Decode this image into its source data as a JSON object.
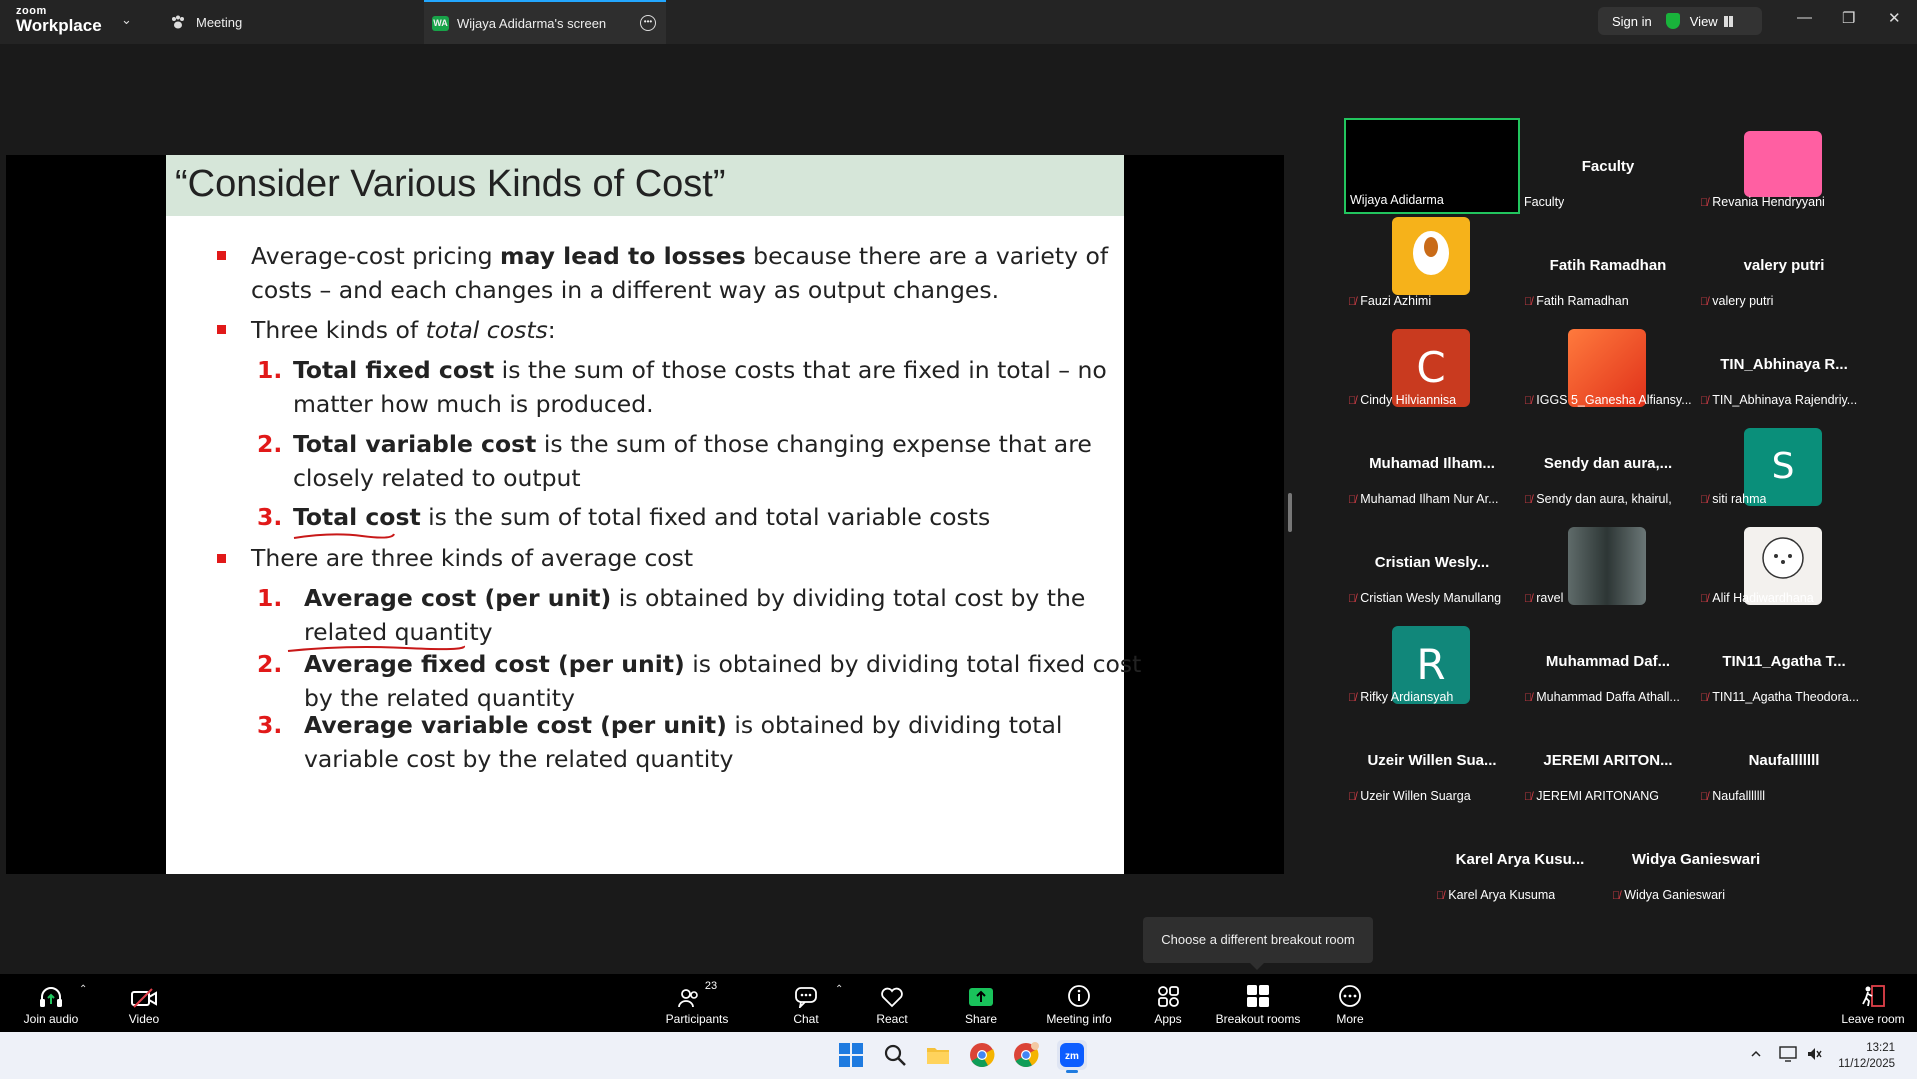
{
  "titlebar": {
    "logo_top": "zoom",
    "logo_bottom": "Workplace",
    "tab_meeting": "Meeting",
    "tab_screen_badge": "WA",
    "tab_screen": "Wijaya Adidarma's screen",
    "sign_in": "Sign in",
    "view": "View"
  },
  "slide": {
    "title": "“Consider Various Kinds of Cost”",
    "b1_pre": "Average-cost pricing ",
    "b1_bold": "may lead to losses",
    "b1_post": " because there are a variety of",
    "b1_line2": "costs – and each changes in a different way as output changes.",
    "b2_pre": "Three kinds of ",
    "b2_ital": "total costs",
    "b2_post": ":",
    "n1": "1.",
    "t1_bold": "Total fixed cost",
    "t1_rest": " is the sum of those costs that are fixed in total – no",
    "t1_line2": "matter how much is produced.",
    "n2": "2.",
    "t2_bold": "Total variable cost",
    "t2_rest": " is the sum of those changing expense that are",
    "t2_line2": "closely related to output",
    "n3": "3.",
    "t3_bold": "Total cost",
    "t3_rest": " is the sum of total fixed and total variable costs",
    "b3": "There are three kinds of average cost",
    "a1_bold": "Average cost (per unit)",
    "a1_rest": " is obtained by dividing total cost by the",
    "a1_line2": "related quantity",
    "a2_bold": "Average fixed cost (per unit)",
    "a2_rest": " is obtained by dividing total fixed cost",
    "a2_line2": "by the related quantity",
    "a3_bold": "Average variable cost (per unit)",
    "a3_rest": " is obtained by dividing total",
    "a3_line2": "variable cost by the related quantity"
  },
  "gallery": [
    {
      "name": "",
      "label": "Wijaya Adidarma",
      "muted": false
    },
    {
      "name": "Faculty",
      "label": "Faculty",
      "muted": false
    },
    {
      "name": "",
      "label": "Revania Hendryyani",
      "muted": true
    },
    {
      "name": "",
      "label": "Fauzi Azhimi",
      "muted": true
    },
    {
      "name": "Fatih Ramadhan",
      "label": "Fatih Ramadhan",
      "muted": true
    },
    {
      "name": "valery putri",
      "label": "valery putri",
      "muted": true
    },
    {
      "name": "",
      "avatar": "C",
      "label": "Cindy Hilviannisa",
      "muted": true
    },
    {
      "name": "",
      "label": "IGGS 5_Ganesha Alfiansy...",
      "muted": true
    },
    {
      "name": "TIN_Abhinaya R...",
      "label": "TIN_Abhinaya Rajendriy...",
      "muted": true
    },
    {
      "name": "Muhamad Ilham...",
      "label": "Muhamad Ilham Nur Ar...",
      "muted": true
    },
    {
      "name": "Sendy dan aura,...",
      "label": "Sendy dan aura, khairul,",
      "muted": true
    },
    {
      "name": "",
      "avatar": "S",
      "label": "siti rahma",
      "muted": true
    },
    {
      "name": "Cristian Wesly...",
      "label": "Cristian Wesly Manullang",
      "muted": true
    },
    {
      "name": "",
      "label": "ravel",
      "muted": true
    },
    {
      "name": "",
      "label": "Alif Hadiwardhana",
      "muted": true
    },
    {
      "name": "",
      "avatar": "R",
      "label": "Rifky Ardiansyah",
      "muted": true
    },
    {
      "name": "Muhammad Daf...",
      "label": "Muhammad Daffa Athall...",
      "muted": true
    },
    {
      "name": "TIN11_Agatha T...",
      "label": "TIN11_Agatha Theodora...",
      "muted": true
    },
    {
      "name": "Uzeir Willen Sua...",
      "label": "Uzeir Willen Suarga",
      "muted": true
    },
    {
      "name": "JEREMI ARITON...",
      "label": "JEREMI ARITONANG",
      "muted": true
    },
    {
      "name": "Naufalllllll",
      "label": "Naufalllllll",
      "muted": true
    },
    {
      "name": "Karel Arya Kusu...",
      "label": "Karel Arya Kusuma",
      "muted": true
    },
    {
      "name": "Widya Ganieswari",
      "label": "Widya Ganieswari",
      "muted": true
    }
  ],
  "tooltip": "Choose a different breakout room",
  "toolbar": {
    "join_audio": "Join audio",
    "video": "Video",
    "participants": "Participants",
    "participants_count": "23",
    "chat": "Chat",
    "react": "React",
    "share": "Share",
    "meeting_info": "Meeting info",
    "apps": "Apps",
    "breakout_rooms": "Breakout rooms",
    "more": "More",
    "leave_room": "Leave room"
  },
  "taskbar": {
    "time": "13:21",
    "date": "11/12/2025"
  },
  "colors": {
    "slide_title_bg": "#d6e6d9",
    "accent_red": "#e11919",
    "share_green": "#19c25b"
  }
}
